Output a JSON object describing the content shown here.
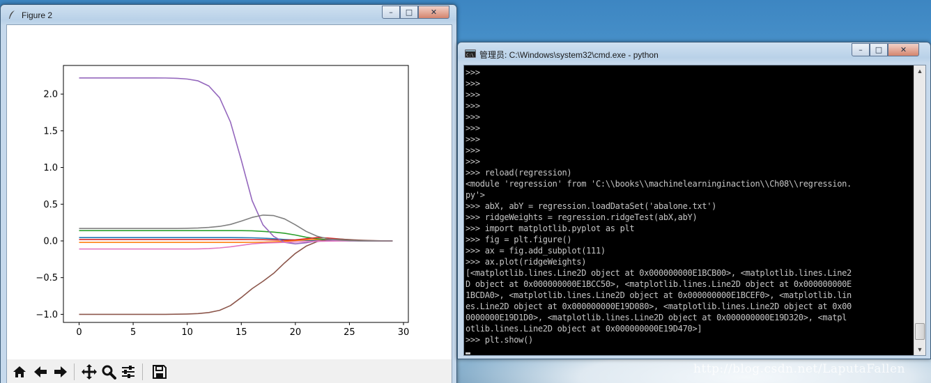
{
  "figure_window": {
    "title": "Figure 2",
    "controls": {
      "minimize": "–",
      "maximize": "□",
      "close": "✕"
    },
    "toolbar": [
      {
        "name": "home-icon"
      },
      {
        "name": "back-arrow-icon"
      },
      {
        "name": "forward-arrow-icon"
      },
      {
        "name": "pan-icon"
      },
      {
        "name": "zoom-icon"
      },
      {
        "name": "configure-subplots-icon"
      },
      {
        "name": "save-icon"
      }
    ]
  },
  "chart_data": {
    "type": "line",
    "title": "",
    "xlabel": "",
    "ylabel": "",
    "xlim": [
      -1.45,
      30.45
    ],
    "ylim": [
      -1.11,
      2.39
    ],
    "x_ticks": [
      "0",
      "5",
      "10",
      "15",
      "20",
      "25",
      "30"
    ],
    "x_tick_values": [
      0,
      5,
      10,
      15,
      20,
      25,
      30
    ],
    "y_ticks": [
      "2.0",
      "1.5",
      "1.0",
      "0.5",
      "0.0",
      "−0.5",
      "−1.0"
    ],
    "y_tick_values": [
      2.0,
      1.5,
      1.0,
      0.5,
      0.0,
      -0.5,
      -1.0
    ],
    "grid": false,
    "x": [
      0,
      1,
      2,
      3,
      4,
      5,
      6,
      7,
      8,
      9,
      10,
      11,
      12,
      13,
      14,
      15,
      16,
      17,
      18,
      19,
      20,
      21,
      22,
      23,
      24,
      25,
      26,
      27,
      28,
      29
    ],
    "series": [
      {
        "color": "#1f77b4",
        "values": [
          0.045,
          0.045,
          0.045,
          0.045,
          0.045,
          0.045,
          0.045,
          0.045,
          0.045,
          0.045,
          0.045,
          0.045,
          0.045,
          0.045,
          0.045,
          0.044,
          0.042,
          0.038,
          0.03,
          0.02,
          0.012,
          0.007,
          0.005,
          0.003,
          0.002,
          0.001,
          0.001,
          0.0,
          0.0,
          0.0
        ]
      },
      {
        "color": "#ff7f0e",
        "values": [
          -0.02,
          -0.02,
          -0.02,
          -0.02,
          -0.02,
          -0.02,
          -0.02,
          -0.02,
          -0.02,
          -0.02,
          -0.02,
          -0.02,
          -0.02,
          -0.02,
          -0.02,
          -0.02,
          -0.019,
          -0.017,
          -0.013,
          -0.006,
          0.005,
          0.015,
          0.02,
          0.018,
          0.012,
          0.007,
          0.004,
          0.002,
          0.001,
          0.0
        ]
      },
      {
        "color": "#2ca02c",
        "values": [
          0.14,
          0.14,
          0.14,
          0.14,
          0.14,
          0.14,
          0.14,
          0.14,
          0.14,
          0.14,
          0.14,
          0.14,
          0.14,
          0.14,
          0.14,
          0.14,
          0.138,
          0.13,
          0.12,
          0.105,
          0.08,
          0.05,
          0.03,
          0.015,
          0.008,
          0.004,
          0.002,
          0.001,
          0.0,
          0.0
        ]
      },
      {
        "color": "#d62728",
        "values": [
          0.02,
          0.02,
          0.02,
          0.02,
          0.02,
          0.02,
          0.02,
          0.02,
          0.02,
          0.02,
          0.02,
          0.02,
          0.02,
          0.02,
          0.02,
          0.02,
          0.019,
          0.017,
          0.013,
          0.01,
          0.015,
          0.03,
          0.045,
          0.04,
          0.028,
          0.015,
          0.007,
          0.003,
          0.001,
          0.0
        ]
      },
      {
        "color": "#9467bd",
        "values": [
          2.22,
          2.22,
          2.22,
          2.22,
          2.22,
          2.22,
          2.22,
          2.22,
          2.219,
          2.215,
          2.205,
          2.18,
          2.11,
          1.95,
          1.62,
          1.1,
          0.55,
          0.22,
          0.06,
          -0.02,
          -0.04,
          -0.025,
          0.0,
          0.015,
          0.01,
          0.005,
          0.002,
          0.001,
          0.0,
          0.0
        ]
      },
      {
        "color": "#8c564b",
        "values": [
          -1.0,
          -1.0,
          -1.0,
          -1.0,
          -1.0,
          -1.0,
          -1.0,
          -1.0,
          -1.0,
          -0.998,
          -0.995,
          -0.99,
          -0.975,
          -0.945,
          -0.88,
          -0.77,
          -0.65,
          -0.55,
          -0.44,
          -0.3,
          -0.17,
          -0.07,
          -0.01,
          0.02,
          0.025,
          0.018,
          0.01,
          0.005,
          0.002,
          0.0
        ]
      },
      {
        "color": "#e377c2",
        "values": [
          -0.11,
          -0.11,
          -0.11,
          -0.11,
          -0.11,
          -0.11,
          -0.11,
          -0.11,
          -0.11,
          -0.11,
          -0.11,
          -0.108,
          -0.104,
          -0.095,
          -0.08,
          -0.06,
          -0.04,
          -0.03,
          -0.025,
          -0.02,
          -0.015,
          -0.01,
          -0.006,
          -0.003,
          -0.001,
          0.0,
          0.0,
          0.0,
          0.0,
          0.0
        ]
      },
      {
        "color": "#7f7f7f",
        "values": [
          0.17,
          0.17,
          0.17,
          0.17,
          0.17,
          0.17,
          0.17,
          0.17,
          0.17,
          0.17,
          0.172,
          0.176,
          0.184,
          0.198,
          0.225,
          0.27,
          0.32,
          0.352,
          0.345,
          0.3,
          0.22,
          0.13,
          0.065,
          0.028,
          0.012,
          0.005,
          0.002,
          0.001,
          0.0,
          0.0
        ]
      }
    ]
  },
  "cmd_window": {
    "title": "管理员: C:\\Windows\\system32\\cmd.exe - python",
    "controls": {
      "minimize": "–",
      "maximize": "□",
      "close": "✕"
    },
    "lines": [
      ">>>",
      ">>>",
      ">>>",
      ">>>",
      ">>>",
      ">>>",
      ">>>",
      ">>>",
      ">>>",
      ">>> reload(regression)",
      "<module 'regression' from 'C:\\\\books\\\\machinelearninginaction\\\\Ch08\\\\regression.",
      "py'>",
      ">>> abX, abY = regression.loadDataSet('abalone.txt')",
      ">>> ridgeWeights = regression.ridgeTest(abX,abY)",
      ">>> import matplotlib.pyplot as plt",
      ">>> fig = plt.figure()",
      ">>> ax = fig.add_subplot(111)",
      ">>> ax.plot(ridgeWeights)",
      "[<matplotlib.lines.Line2D object at 0x000000000E1BCB00>, <matplotlib.lines.Line2",
      "D object at 0x000000000E1BCC50>, <matplotlib.lines.Line2D object at 0x000000000E",
      "1BCDA0>, <matplotlib.lines.Line2D object at 0x000000000E1BCEF0>, <matplotlib.lin",
      "es.Line2D object at 0x000000000E19D080>, <matplotlib.lines.Line2D object at 0x00",
      "0000000E19D1D0>, <matplotlib.lines.Line2D object at 0x000000000E19D320>, <matpl",
      "otlib.lines.Line2D object at 0x000000000E19D470>]",
      ">>> plt.show()"
    ]
  },
  "watermark": "http://blog.csdn.net/LaputaFallen"
}
